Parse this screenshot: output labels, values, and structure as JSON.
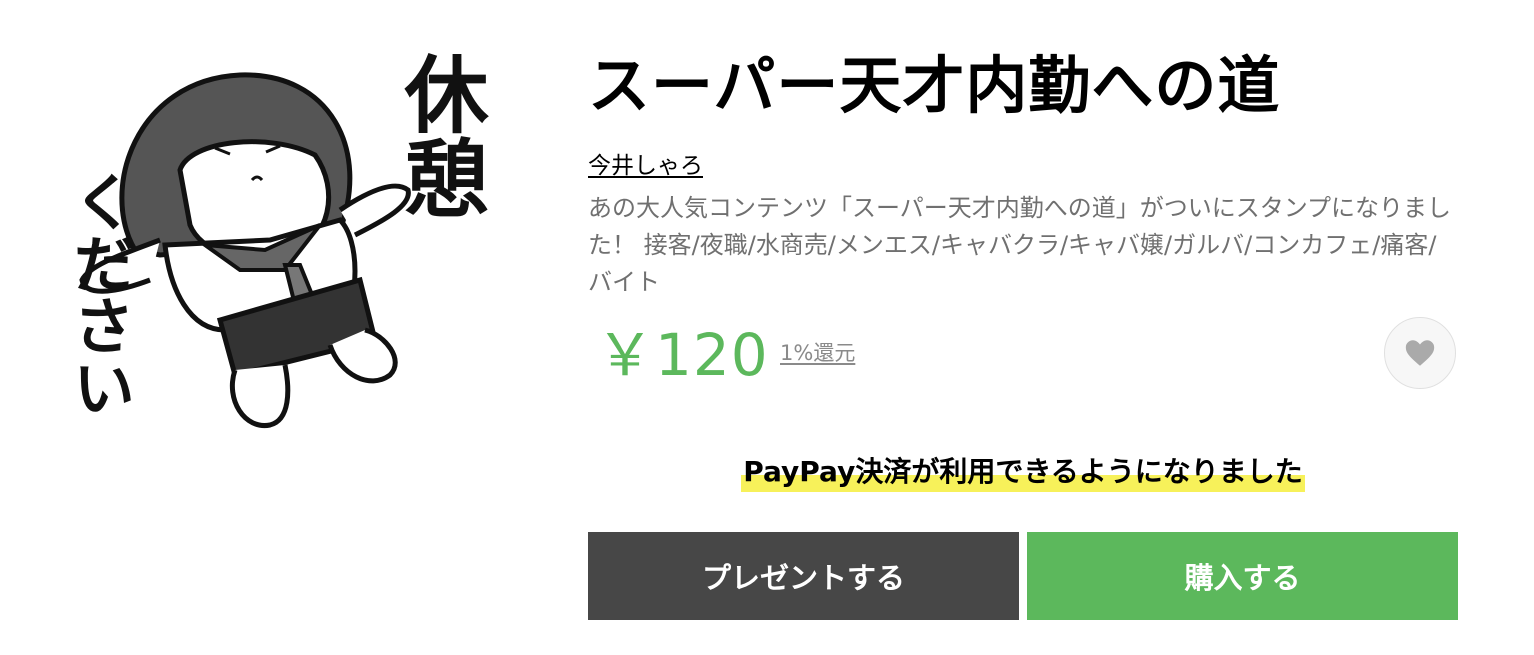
{
  "sticker": {
    "text_right": "休憩",
    "text_left": "ください"
  },
  "product": {
    "title": "スーパー天才内勤への道",
    "author": "今井しゃろ",
    "description": "あの大人気コンテンツ「スーパー天才内勤への道」がついにスタンプになりました！ 接客/夜職/水商売/メンエス/キャバクラ/キャバ嬢/ガルバ/コンカフェ/痛客/バイト",
    "price": "￥120",
    "cashback": "1%還元",
    "favorite_icon": "heart-icon"
  },
  "notice": {
    "text": "PayPay決済が利用できるようになりました",
    "highlight_color": "#f7f15a"
  },
  "actions": {
    "gift_label": "プレゼントする",
    "buy_label": "購入する"
  },
  "colors": {
    "price": "#5cb85c",
    "buy_button": "#5cb85c",
    "gift_button": "#474747"
  }
}
